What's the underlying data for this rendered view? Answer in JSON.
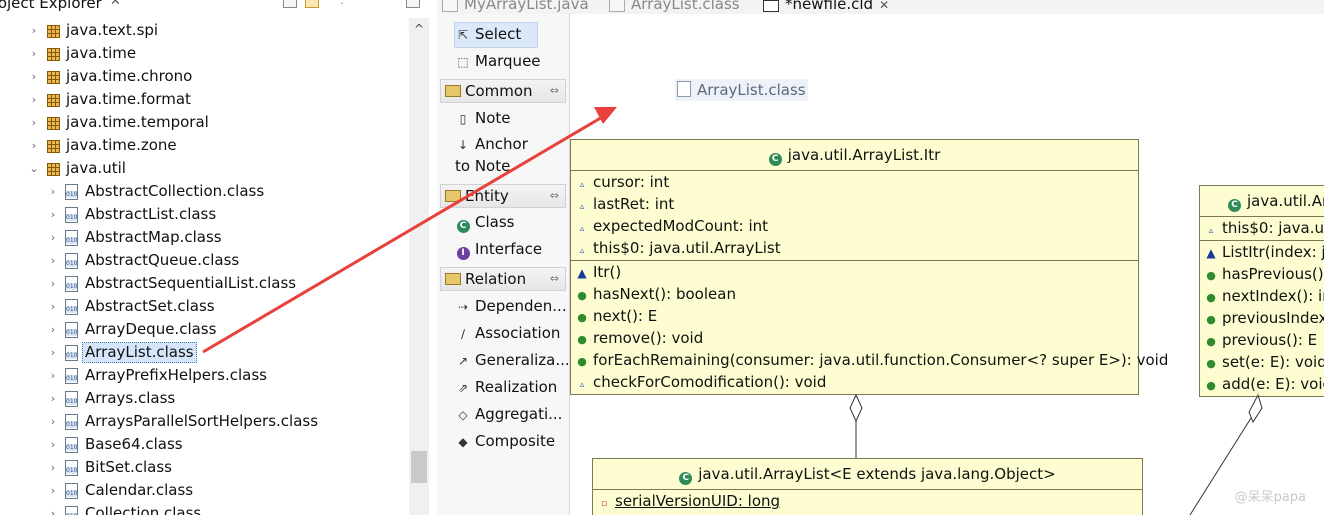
{
  "explorer": {
    "title": "roject Explorer",
    "close_glyph": "✕",
    "tree": [
      {
        "label": "java.text.spi",
        "kind": "package",
        "expanded": false
      },
      {
        "label": "java.time",
        "kind": "package",
        "expanded": false
      },
      {
        "label": "java.time.chrono",
        "kind": "package",
        "expanded": false
      },
      {
        "label": "java.time.format",
        "kind": "package",
        "expanded": false
      },
      {
        "label": "java.time.temporal",
        "kind": "package",
        "expanded": false
      },
      {
        "label": "java.time.zone",
        "kind": "package",
        "expanded": false
      },
      {
        "label": "java.util",
        "kind": "package",
        "expanded": true
      },
      {
        "label": "AbstractCollection.class",
        "kind": "class"
      },
      {
        "label": "AbstractList.class",
        "kind": "class"
      },
      {
        "label": "AbstractMap.class",
        "kind": "class"
      },
      {
        "label": "AbstractQueue.class",
        "kind": "class"
      },
      {
        "label": "AbstractSequentialList.class",
        "kind": "class"
      },
      {
        "label": "AbstractSet.class",
        "kind": "class"
      },
      {
        "label": "ArrayDeque.class",
        "kind": "class"
      },
      {
        "label": "ArrayList.class",
        "kind": "class",
        "selected": true
      },
      {
        "label": "ArrayPrefixHelpers.class",
        "kind": "class"
      },
      {
        "label": "Arrays.class",
        "kind": "class"
      },
      {
        "label": "ArraysParallelSortHelpers.class",
        "kind": "class"
      },
      {
        "label": "Base64.class",
        "kind": "class"
      },
      {
        "label": "BitSet.class",
        "kind": "class"
      },
      {
        "label": "Calendar.class",
        "kind": "class"
      },
      {
        "label": "Collection.class",
        "kind": "class"
      }
    ]
  },
  "tabs": [
    {
      "label": "MyArrayList.java",
      "active": false
    },
    {
      "label": "ArrayList.class",
      "active": false
    },
    {
      "label": "*newfile.cld",
      "active": true,
      "close": "✕"
    }
  ],
  "palette": {
    "tools": [
      {
        "label": "Select",
        "icon": "arrow-cursor-icon",
        "glyph": "⇱",
        "selected": true
      },
      {
        "label": "Marquee",
        "icon": "marquee-icon",
        "glyph": "⬚"
      }
    ],
    "drawers": [
      {
        "label": "Common",
        "items": [
          {
            "label": "Note",
            "icon": "note-icon",
            "glyph": "▯"
          },
          {
            "label": "Anchor to Note",
            "icon": "anchor-icon",
            "glyph": "↓"
          }
        ]
      },
      {
        "label": "Entity",
        "items": [
          {
            "label": "Class",
            "icon": "class-icon",
            "glyph": "C",
            "color": "#2e8b57"
          },
          {
            "label": "Interface",
            "icon": "interface-icon",
            "glyph": "I",
            "color": "#6a3fa0"
          }
        ]
      },
      {
        "label": "Relation",
        "items": [
          {
            "label": "Dependen...",
            "icon": "dependency-icon",
            "glyph": "⇢"
          },
          {
            "label": "Association",
            "icon": "association-icon",
            "glyph": "∕"
          },
          {
            "label": "Generaliza...",
            "icon": "generalization-icon",
            "glyph": "↗"
          },
          {
            "label": "Realization",
            "icon": "realization-icon",
            "glyph": "⇗"
          },
          {
            "label": "Aggregati...",
            "icon": "aggregation-icon",
            "glyph": "◇"
          },
          {
            "label": "Composite",
            "icon": "composite-icon",
            "glyph": "◆"
          }
        ]
      }
    ]
  },
  "diagram": {
    "floating_label": "ArrayList.class",
    "itr": {
      "title": "java.util.ArrayList.Itr",
      "fields": [
        "cursor: int",
        "lastRet: int",
        "expectedModCount: int",
        "this$0: java.util.ArrayList"
      ],
      "methods": [
        {
          "label": "Itr()",
          "vis": "ctor"
        },
        {
          "label": "hasNext(): boolean",
          "vis": "pub"
        },
        {
          "label": "next(): E",
          "vis": "pub"
        },
        {
          "label": "remove(): void",
          "vis": "pub"
        },
        {
          "label": "forEachRemaining(consumer: java.util.function.Consumer<? super E>): void",
          "vis": "pub"
        },
        {
          "label": "checkForComodification(): void",
          "vis": "pkg"
        }
      ]
    },
    "listitr": {
      "title": "java.util.Ar",
      "fields": [
        "this$0: java.uti"
      ],
      "methods": [
        {
          "label": "ListItr(index: ja",
          "vis": "ctor"
        },
        {
          "label": "hasPrevious():",
          "vis": "pub"
        },
        {
          "label": "nextIndex(): in",
          "vis": "pub"
        },
        {
          "label": "previousIndex",
          "vis": "pub"
        },
        {
          "label": "previous(): E",
          "vis": "pub"
        },
        {
          "label": "set(e: E): void",
          "vis": "pub"
        },
        {
          "label": "add(e: E): void",
          "vis": "pub"
        }
      ]
    },
    "arraylist": {
      "title": "java.util.ArrayList<E extends java.lang.Object>",
      "fields": [
        "serialVersionUID: long"
      ]
    },
    "arrow_color": "#e8403a",
    "box_fill": "#fefdd1"
  },
  "watermark": "@呆呆papa"
}
